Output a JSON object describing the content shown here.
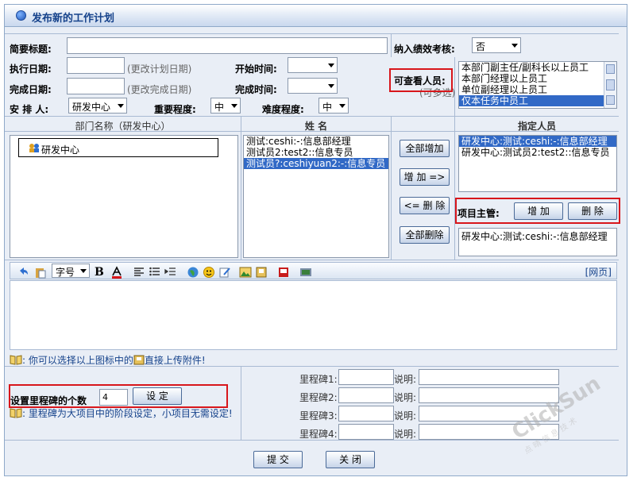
{
  "window": {
    "title": "发布新的工作计划"
  },
  "form": {
    "summary_label": "简要标题:",
    "summary_value": "",
    "perf_label": "纳入绩效考核:",
    "perf_value": "否",
    "exec_date_label": "执行日期:",
    "exec_date_hint": "(更改计划日期)",
    "start_time_label": "开始时间:",
    "finish_date_label": "完成日期:",
    "finish_date_hint": "(更改完成日期)",
    "finish_time_label": "完成时间:",
    "arrange_label": "安 排 人:",
    "arrange_value": "研发中心",
    "importance_label": "重要程度:",
    "importance_value": "中",
    "difficulty_label": "难度程度:",
    "difficulty_value": "中",
    "viewers_label": "可查看人员:",
    "viewers_hint": "(可多选)",
    "viewers_options": [
      "本部门副主任/副科长以上员工",
      "本部门经理以上员工",
      "单位副经理以上员工",
      "仅本任务中员工"
    ]
  },
  "assign": {
    "dept_header": "部门名称（研发中心）",
    "name_header": "姓 名",
    "assigned_header": "指定人员",
    "tree_node": "研发中心",
    "names": [
      "测试:ceshi:-:信息部经理",
      "测试员2:test2::信息专员",
      "测试员?:ceshiyuan2:-:信息专员"
    ],
    "assigned": [
      "研发中心:测试:ceshi:-:信息部经理",
      "研发中心:测试员2:test2::信息专员"
    ],
    "add_all": "全部增加",
    "add": "增 加 =>",
    "remove": "<= 删 除",
    "remove_all": "全部删除",
    "manager_label": "项目主管:",
    "manager_add": "增 加",
    "manager_remove": "删 除",
    "manager_value": "研发中心:测试:ceshi:-:信息部经理"
  },
  "editor": {
    "font_select": "字号",
    "web_link": "[网页]",
    "hint_part1": ": 你可以选择以上图标中的",
    "hint_part2": "直接上传附件!"
  },
  "milestone": {
    "count_label": "设置里程碑的个数",
    "count_value": "4",
    "set_button": "设 定",
    "note": ": 里程碑为大项目中的阶段设定，小项目无需设定!",
    "items": [
      {
        "label": "里程碑1:",
        "desc_label": "说明:"
      },
      {
        "label": "里程碑2:",
        "desc_label": "说明:"
      },
      {
        "label": "里程碑3:",
        "desc_label": "说明:"
      },
      {
        "label": "里程碑4:",
        "desc_label": "说明:"
      }
    ]
  },
  "actions": {
    "submit": "提 交",
    "close": "关 闭"
  },
  "watermark": {
    "brand": "ClickSun",
    "sub": "点 晴 信 息 技 术"
  },
  "colors": {
    "accent": "#15428b",
    "highlight": "#d8161b",
    "selection": "#3169c6"
  }
}
